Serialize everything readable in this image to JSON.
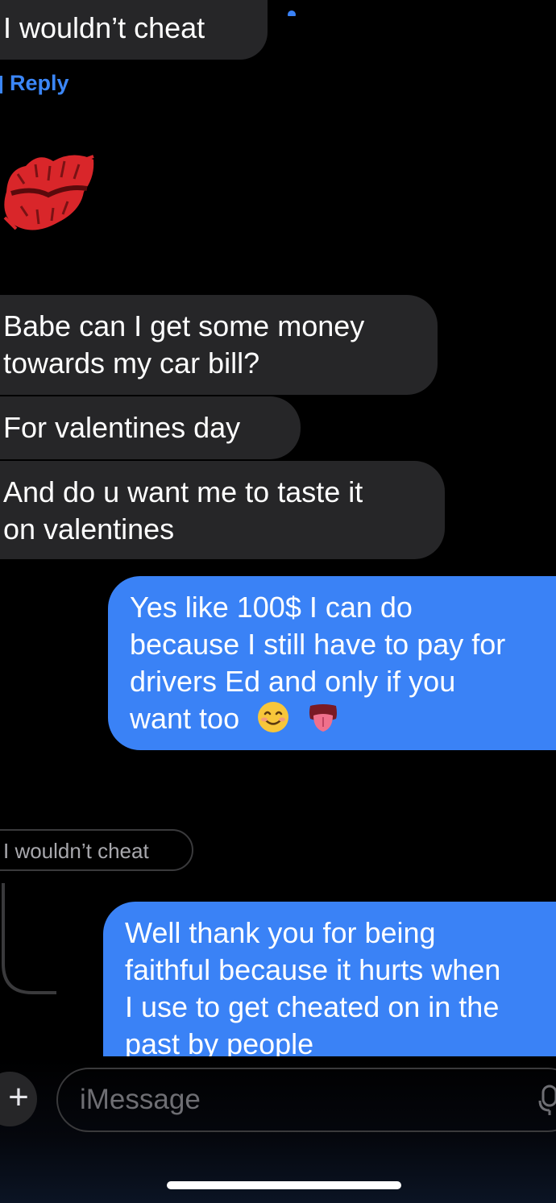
{
  "thread": {
    "messages": [
      {
        "id": "top",
        "direction": "incoming",
        "text": "I wouldn’t cheat"
      },
      {
        "id": "money",
        "direction": "incoming",
        "lines": [
          "Babe can I get some money",
          "towards my car bill?"
        ]
      },
      {
        "id": "valentines",
        "direction": "incoming",
        "text": "For valentines day"
      },
      {
        "id": "taste",
        "direction": "incoming",
        "lines": [
          "And do u want me to taste it",
          "on valentines"
        ]
      },
      {
        "id": "yes",
        "direction": "outgoing",
        "lines": [
          "Yes like 100$ I can do",
          "because I still have to pay for",
          "drivers Ed and only if you",
          "want too"
        ],
        "emojis": [
          "smiling-face-icon",
          "tongue-face-icon"
        ]
      },
      {
        "id": "thank",
        "direction": "outgoing",
        "quoted": "I wouldn’t cheat",
        "lines": [
          "Well thank you for being",
          "faithful because it hurts when",
          "I use to get cheated on in the",
          "past by people"
        ]
      }
    ],
    "reply_link": "Reply",
    "sticker": "lips-kiss-icon",
    "tapback": "tapback-bubble-icon"
  },
  "composer": {
    "placeholder": "iMessage",
    "plus_icon": "+",
    "mic_icon": "microphone-icon"
  },
  "colors": {
    "incoming": "#262628",
    "outgoing": "#3a82f6",
    "link": "#3b86f7",
    "background": "#000000"
  }
}
